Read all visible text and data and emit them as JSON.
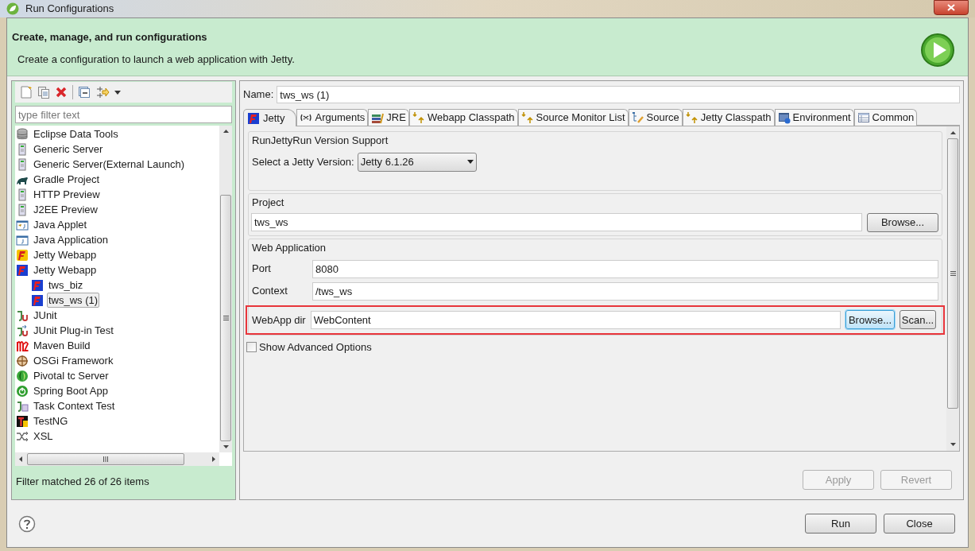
{
  "window": {
    "title": "Run Configurations"
  },
  "header": {
    "title": "Create, manage, and run configurations",
    "message": "Create a configuration to launch a web application with Jetty."
  },
  "filter": {
    "placeholder": "type filter text"
  },
  "tree": [
    {
      "label": "Eclipse Data Tools",
      "selected": false
    },
    {
      "label": "Generic Server",
      "selected": false
    },
    {
      "label": "Generic Server(External Launch)",
      "selected": false
    },
    {
      "label": "Gradle Project",
      "selected": false
    },
    {
      "label": "HTTP Preview",
      "selected": false
    },
    {
      "label": "J2EE Preview",
      "selected": false
    },
    {
      "label": "Java Applet",
      "selected": false
    },
    {
      "label": "Java Application",
      "selected": false
    },
    {
      "label": "Jetty Webapp",
      "selected": false
    },
    {
      "label": "Jetty Webapp",
      "selected": false,
      "children": [
        {
          "label": "tws_biz",
          "selected": false
        },
        {
          "label": "tws_ws (1)",
          "selected": true
        }
      ]
    },
    {
      "label": "JUnit",
      "selected": false
    },
    {
      "label": "JUnit Plug-in Test",
      "selected": false
    },
    {
      "label": "Maven Build",
      "selected": false
    },
    {
      "label": "OSGi Framework",
      "selected": false
    },
    {
      "label": "Pivotal tc Server",
      "selected": false
    },
    {
      "label": "Spring Boot App",
      "selected": false
    },
    {
      "label": "Task Context Test",
      "selected": false
    },
    {
      "label": "TestNG",
      "selected": false
    },
    {
      "label": "XSL",
      "selected": false
    }
  ],
  "filter_status": "Filter matched 26 of 26 items",
  "name_field": {
    "label": "Name:",
    "value": "tws_ws (1)"
  },
  "tabs": [
    {
      "label": "Jetty",
      "selected": true
    },
    {
      "label": "Arguments",
      "selected": false
    },
    {
      "label": "JRE",
      "selected": false
    },
    {
      "label": "Webapp Classpath",
      "selected": false
    },
    {
      "label": "Source Monitor List",
      "selected": false
    },
    {
      "label": "Source",
      "selected": false
    },
    {
      "label": "Jetty Classpath",
      "selected": false
    },
    {
      "label": "Environment",
      "selected": false
    },
    {
      "label": "Common",
      "selected": false
    }
  ],
  "version_group": {
    "title": "RunJettyRun Version Support",
    "label": "Select a Jetty Version:",
    "value": "Jetty 6.1.26"
  },
  "project_group": {
    "title": "Project",
    "value": "tws_ws",
    "button": "Browse..."
  },
  "webapp_group": {
    "title": "Web Application",
    "port_label": "Port",
    "port": "8080",
    "context_label": "Context",
    "context": "/tws_ws",
    "dir_label": "WebApp dir",
    "dir": "WebContent",
    "browse": "Browse...",
    "scan": "Scan..."
  },
  "advanced": {
    "label": "Show Advanced Options",
    "checked": false
  },
  "apply_buttons": [
    {
      "label": "Apply",
      "disabled": true
    },
    {
      "label": "Revert",
      "disabled": true
    }
  ],
  "footer_buttons": [
    {
      "label": "Run"
    },
    {
      "label": "Close"
    }
  ]
}
